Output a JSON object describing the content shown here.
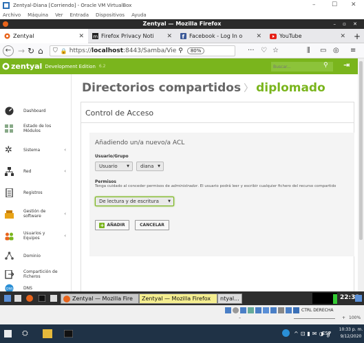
{
  "vbox": {
    "title": "Zentyal-Diana [Corriendo] - Oracle VM VirtualBox",
    "menu": [
      "Archivo",
      "Máquina",
      "Ver",
      "Entrada",
      "Dispositivos",
      "Ayuda"
    ],
    "controls": [
      "–",
      "☐",
      "✕"
    ]
  },
  "firefox": {
    "window_title": "Zentyal — Mozilla Firefox",
    "window_controls": "– ▫ ✕",
    "tabs": [
      {
        "label": "Zentyal",
        "active": true
      },
      {
        "label": "Firefox Privacy Noti",
        "active": false
      },
      {
        "label": "Facebook - Log In o",
        "active": false
      },
      {
        "label": "YouTube",
        "active": false
      }
    ],
    "new_tab": "+",
    "url_prefix": "https://",
    "url_host": "localhost",
    "url_rest": ":8443/Samba/Vie",
    "zoom": "80%",
    "more": "···"
  },
  "zentyal": {
    "logo": "zentyal",
    "edition": "Development Edition",
    "version": "6.2",
    "search_placeholder": "Buscar...",
    "sidebar": [
      {
        "label": "Dashboard",
        "icon": "dashboard-icon",
        "chevron": false
      },
      {
        "label": "Estado de los Módulos",
        "icon": "modules-icon",
        "chevron": false
      },
      {
        "label": "Sistema",
        "icon": "gear-icon",
        "chevron": true
      },
      {
        "label": "Red",
        "icon": "network-icon",
        "chevron": true
      },
      {
        "label": "Registros",
        "icon": "document-icon",
        "chevron": false
      },
      {
        "label": "Gestión de software",
        "icon": "software-icon",
        "chevron": true
      },
      {
        "label": "Usuarios y Equipos",
        "icon": "users-icon",
        "chevron": true
      },
      {
        "label": "Dominio",
        "icon": "domain-icon",
        "chevron": false
      },
      {
        "label": "Compartición de Ficheros",
        "icon": "share-icon",
        "chevron": false
      },
      {
        "label": "DNS",
        "icon": "dns-icon",
        "chevron": false
      }
    ],
    "breadcrumb_parent": "Directorios compartidos",
    "breadcrumb_sep": "〉",
    "breadcrumb_current": "diplomado",
    "panel_title": "Control de Acceso",
    "form_title": "Añadiendo un/a nuevo/a ACL",
    "user_group_label": "Usuario/Grupo",
    "user_type_value": "Usuario",
    "user_value": "diana",
    "permisos_label": "Permisos",
    "permisos_help_1": "Tenga cuidado al conceder permisos de ",
    "permisos_help_em": "administrador",
    "permisos_help_2": ". El usuario podrá leer y escribir cualquier fichero del recurso compartido",
    "permisos_value": "De lectura y de escritura",
    "add_button": "AÑADIR",
    "cancel_button": "CANCELAR"
  },
  "guest_taskbar": {
    "item1": "Zentyal — Mozilla Fire",
    "item2": "Zentyal — Mozilla Firefox",
    "item3": "ntyal...",
    "clock": "22:33"
  },
  "vbox_status": {
    "host_key": "CTRL DERECHA",
    "zoom": "100%"
  },
  "host_taskbar": {
    "lang": "ESP",
    "time": "10:33 p. m.",
    "date": "9/12/2020"
  },
  "colors": {
    "zentyal_green": "#7ab51d",
    "firefox_title": "#2b2b2b",
    "host_taskbar": "#1f3246"
  }
}
